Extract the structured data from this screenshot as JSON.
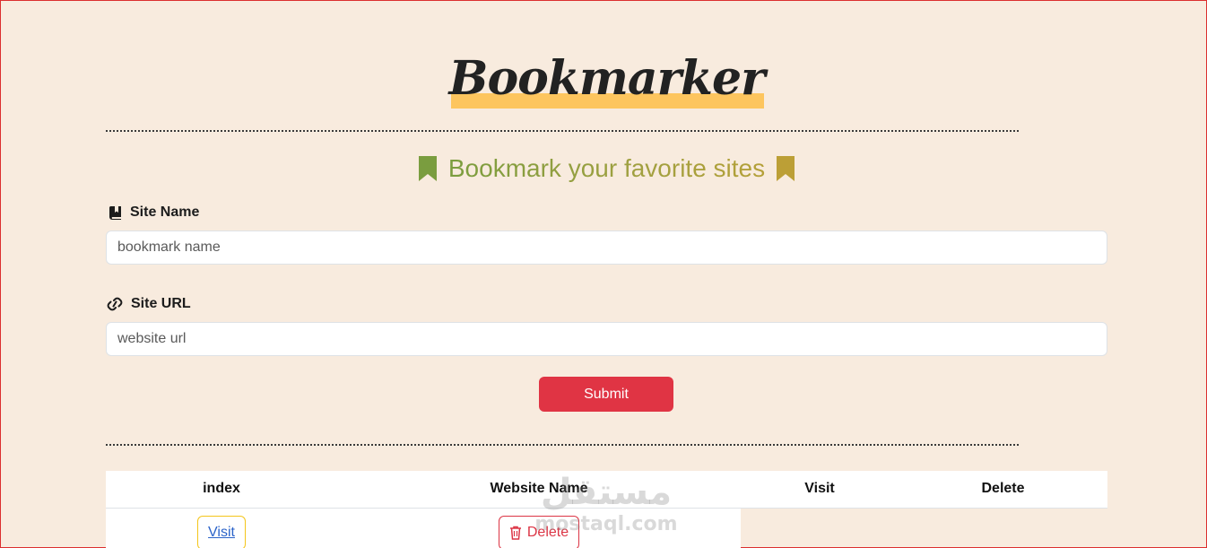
{
  "brand": {
    "title": "Bookmarker",
    "highlight_color": "#fdc55e"
  },
  "tagline": {
    "text": "Bookmark your favorite sites",
    "left_icon": "bookmark-icon",
    "right_icon": "bookmark-icon",
    "gradient_colors": [
      "#7a9d3f",
      "#b5a038"
    ]
  },
  "form": {
    "site_name": {
      "label": "Site Name",
      "icon": "book-bookmark-icon",
      "placeholder": "bookmark name",
      "value": ""
    },
    "site_url": {
      "label": "Site URL",
      "icon": "link-icon",
      "placeholder": "website url",
      "value": ""
    },
    "submit_label": "Submit",
    "submit_color": "#e03444"
  },
  "table": {
    "headers": [
      "index",
      "Website Name",
      "Visit",
      "Delete"
    ],
    "rows": [
      {
        "visit_label": "Visit",
        "delete_label": "Delete"
      }
    ]
  },
  "watermark": {
    "arabic": "مستقل",
    "latin": "mostaql.com"
  }
}
